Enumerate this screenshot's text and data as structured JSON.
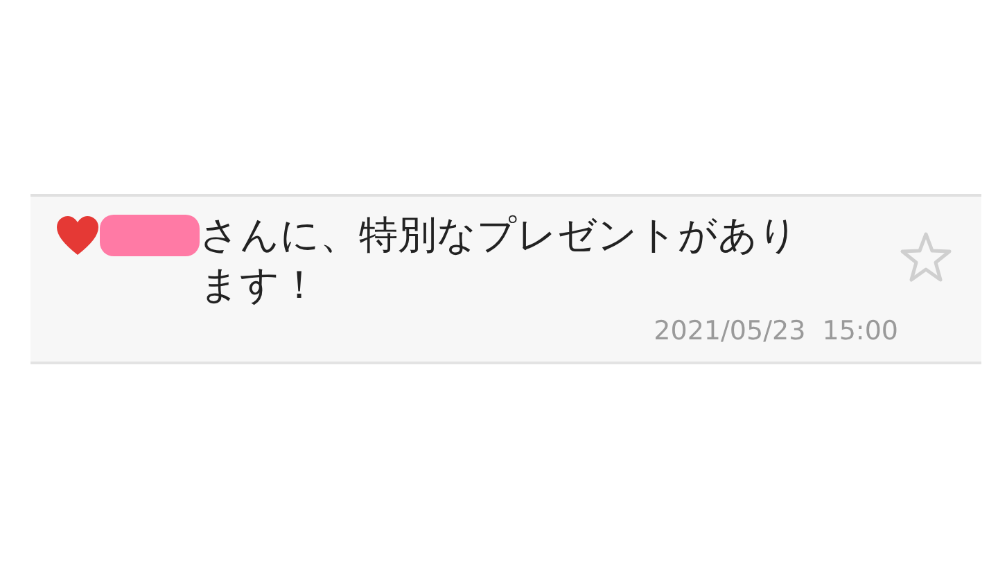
{
  "message": {
    "text": "さんに、特別なプレゼントがあります！",
    "time": "2021/05/23  15:00",
    "starred": false
  }
}
